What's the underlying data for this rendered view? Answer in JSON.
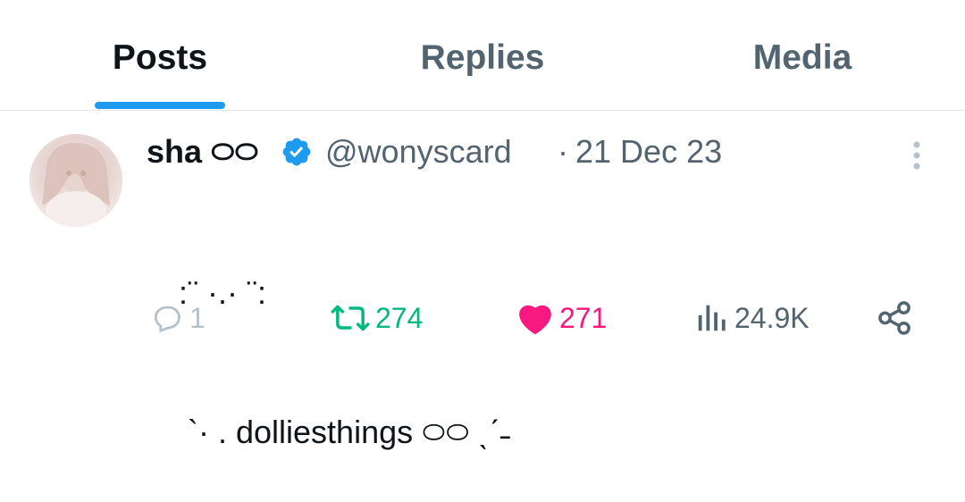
{
  "tabs": [
    {
      "label": "Posts",
      "active": true
    },
    {
      "label": "Replies",
      "active": false
    },
    {
      "label": "Media",
      "active": false
    }
  ],
  "post": {
    "display_name": "sha ࿀࿀",
    "handle": "@wonyscard",
    "separator": "·",
    "date": "21 Dec 23",
    "verified_icon": "verified-badge-icon",
    "text_line1": " :¨ ·.· ¨:",
    "text_line2": "  `· . dolliesthings ࿀࿀ ˎˊ˗",
    "actions": {
      "replies": "1",
      "reposts": "274",
      "likes": "271",
      "views": "24.9K"
    }
  },
  "colors": {
    "accent": "#1d9bf0",
    "repost": "#00ba7c",
    "like": "#f91880",
    "muted": "#536471"
  }
}
